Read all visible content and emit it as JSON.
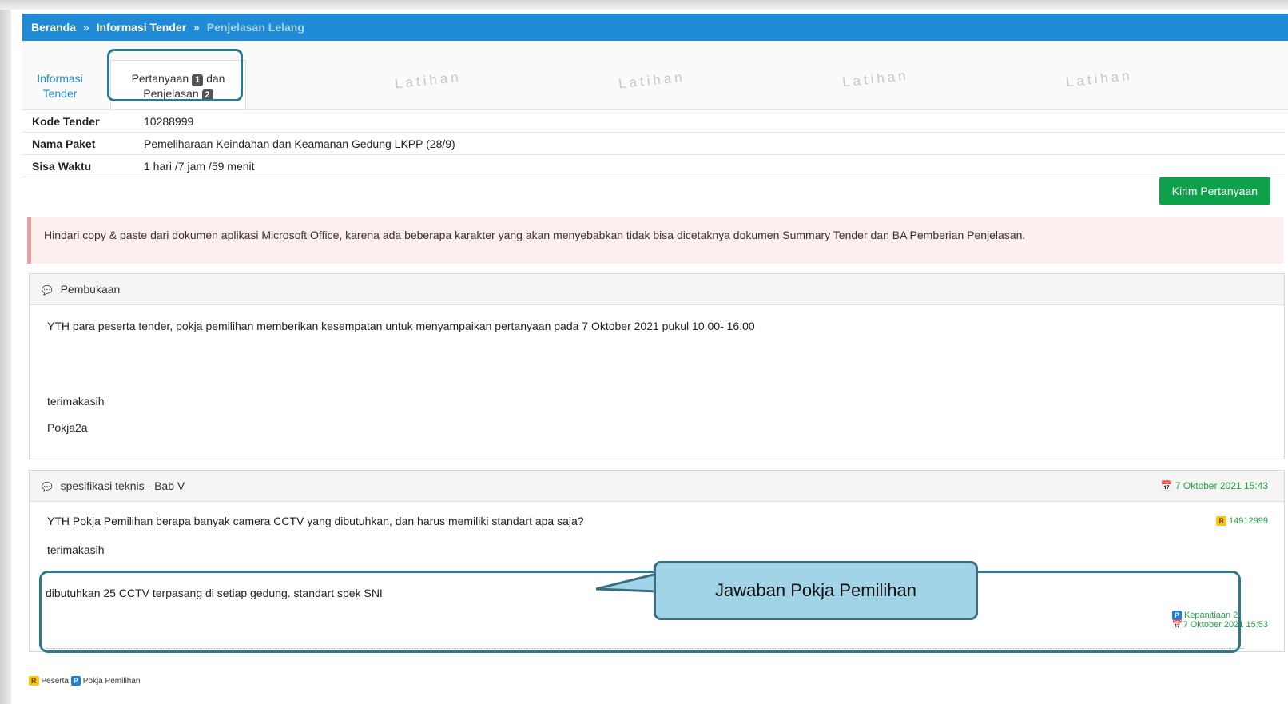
{
  "breadcrumb": {
    "home": "Beranda",
    "separator": "»",
    "section": "Informasi Tender",
    "current": "Penjelasan Lelang"
  },
  "tabs": {
    "info_line1": "Informasi",
    "info_line2": "Tender",
    "qa_line1_a": "Pertanyaan",
    "qa_badge1": "1",
    "qa_line1_b": "dan",
    "qa_line2": "Penjelasan",
    "qa_badge2": "2"
  },
  "watermark": "Latihan",
  "info": {
    "kode_label": "Kode Tender",
    "kode_value": "10288999",
    "nama_label": "Nama Paket",
    "nama_value": "Pemeliharaan Keindahan dan Keamanan Gedung LKPP (28/9)",
    "sisa_label": "Sisa Waktu",
    "sisa_value": "1 hari /7 jam /59 menit"
  },
  "send_button": "Kirim Pertanyaan",
  "alert_text": "Hindari copy & paste dari dokumen aplikasi Microsoft Office, karena ada beberapa karakter yang akan menyebabkan tidak bisa dicetaknya dokumen Summary Tender dan BA Pemberian Penjelasan.",
  "opening": {
    "title": "Pembukaan",
    "message": "YTH para peserta tender, pokja pemilihan memberikan kesempatan untuk menyampaikan pertanyaan pada 7 Oktober 2021 pukul 10.00- 16.00",
    "closing": "terimakasih",
    "signature": "Pokja2a"
  },
  "thread": {
    "title": "spesifikasi teknis - Bab V",
    "date": "7 Oktober 2021 15:43",
    "question": "YTH Pokja Pemilihan berapa banyak camera CCTV yang dibutuhkan, dan harus memiliki standart apa saja?",
    "question_tag": "R",
    "question_user": "14912999",
    "closing": "terimakasih",
    "answer": "dibutuhkan 25 CCTV terpasang di setiap gedung. standart spek SNI",
    "answer_tag": "P",
    "answer_user": "Kepanitiaan 2",
    "answer_date": "7 Oktober 2021 15:53"
  },
  "callout": "Jawaban Pokja Pemilihan",
  "legend": {
    "r_tag": "R",
    "r_label": "Peserta",
    "p_tag": "P",
    "p_label": "Pokja Pemilihan"
  },
  "colors": {
    "header_blue": "#1f8bd6",
    "send_green": "#0ea04b",
    "highlight_teal": "#2b7a8c",
    "callout_fill": "#a2d4e8"
  }
}
